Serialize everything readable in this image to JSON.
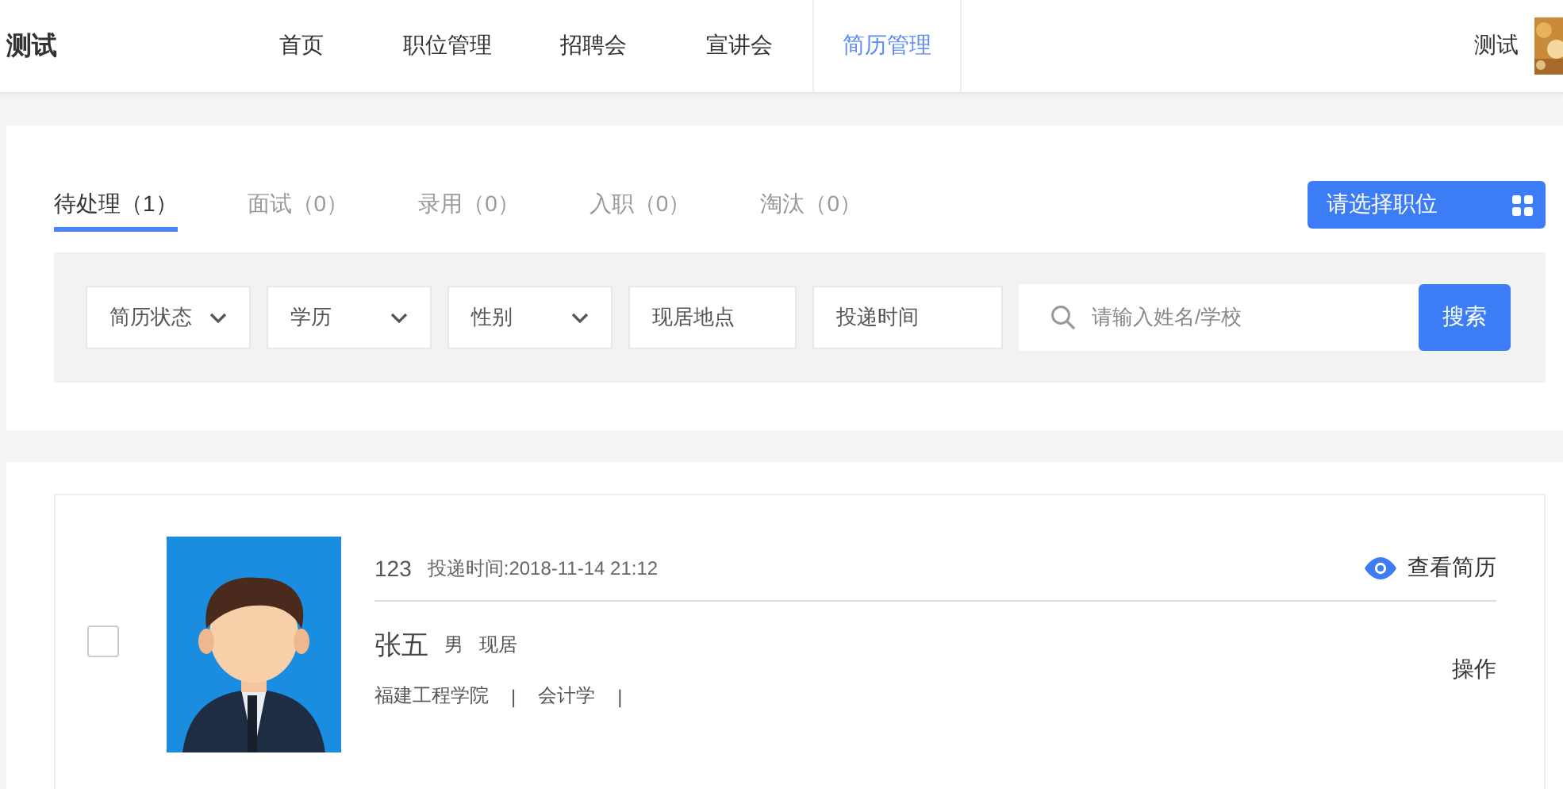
{
  "header": {
    "logo": "测试",
    "nav": [
      {
        "label": "首页",
        "selected": false
      },
      {
        "label": "职位管理",
        "selected": false
      },
      {
        "label": "招聘会",
        "selected": false
      },
      {
        "label": "宣讲会",
        "selected": false
      },
      {
        "label": "简历管理",
        "selected": true
      }
    ],
    "user": {
      "name": "测试"
    }
  },
  "tabs": [
    {
      "label": "待处理（1）",
      "selected": true
    },
    {
      "label": "面试（0）",
      "selected": false
    },
    {
      "label": "录用（0）",
      "selected": false
    },
    {
      "label": "入职（0）",
      "selected": false
    },
    {
      "label": "淘汰（0）",
      "selected": false
    }
  ],
  "position_button": "请选择职位",
  "filters": [
    {
      "kind": "select",
      "label": "简历状态"
    },
    {
      "kind": "select",
      "label": "学历"
    },
    {
      "kind": "select",
      "label": "性别"
    },
    {
      "kind": "text",
      "label": "现居地点"
    },
    {
      "kind": "text",
      "label": "投递时间"
    }
  ],
  "search": {
    "placeholder": "请输入姓名/学校",
    "button": "搜索"
  },
  "resumes": [
    {
      "checked": false,
      "id": "123",
      "submit_time": "投递时间:2018-11-14 21:12",
      "view": "查看简历",
      "name": "张五",
      "gender": "男",
      "residence": "现居",
      "details": [
        {
          "text": "福建工程学院",
          "separator": "|"
        },
        {
          "text": "会计学",
          "separator": "|"
        }
      ],
      "action": "操作"
    }
  ]
}
